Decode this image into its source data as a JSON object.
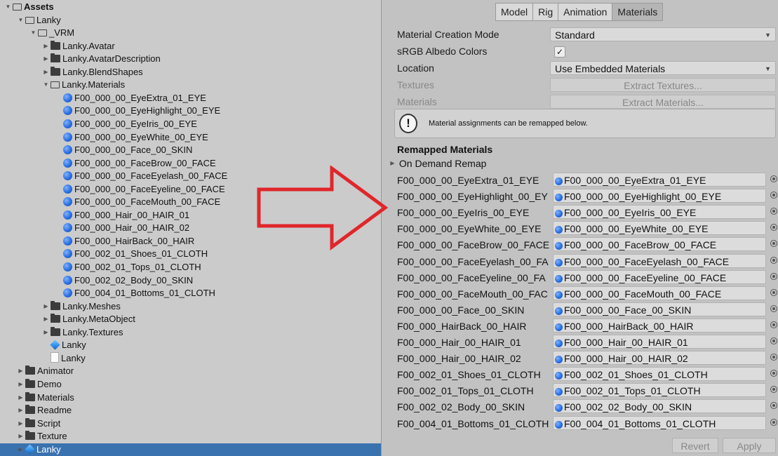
{
  "project_tree": [
    {
      "label": "Assets",
      "depth": 0,
      "expand": "open",
      "icon": "folder-open",
      "bold": true
    },
    {
      "label": "Lanky",
      "depth": 1,
      "expand": "open",
      "icon": "folder-open"
    },
    {
      "label": "_VRM",
      "depth": 2,
      "expand": "open",
      "icon": "folder-open"
    },
    {
      "label": "Lanky.Avatar",
      "depth": 3,
      "expand": "closed",
      "icon": "folder"
    },
    {
      "label": "Lanky.AvatarDescription",
      "depth": 3,
      "expand": "closed",
      "icon": "folder"
    },
    {
      "label": "Lanky.BlendShapes",
      "depth": 3,
      "expand": "closed",
      "icon": "folder"
    },
    {
      "label": "Lanky.Materials",
      "depth": 3,
      "expand": "open",
      "icon": "folder-open"
    },
    {
      "label": "F00_000_00_EyeExtra_01_EYE",
      "depth": 4,
      "expand": "none",
      "icon": "material"
    },
    {
      "label": "F00_000_00_EyeHighlight_00_EYE",
      "depth": 4,
      "expand": "none",
      "icon": "material"
    },
    {
      "label": "F00_000_00_EyeIris_00_EYE",
      "depth": 4,
      "expand": "none",
      "icon": "material"
    },
    {
      "label": "F00_000_00_EyeWhite_00_EYE",
      "depth": 4,
      "expand": "none",
      "icon": "material"
    },
    {
      "label": "F00_000_00_Face_00_SKIN",
      "depth": 4,
      "expand": "none",
      "icon": "material"
    },
    {
      "label": "F00_000_00_FaceBrow_00_FACE",
      "depth": 4,
      "expand": "none",
      "icon": "material"
    },
    {
      "label": "F00_000_00_FaceEyelash_00_FACE",
      "depth": 4,
      "expand": "none",
      "icon": "material"
    },
    {
      "label": "F00_000_00_FaceEyeline_00_FACE",
      "depth": 4,
      "expand": "none",
      "icon": "material"
    },
    {
      "label": "F00_000_00_FaceMouth_00_FACE",
      "depth": 4,
      "expand": "none",
      "icon": "material"
    },
    {
      "label": "F00_000_Hair_00_HAIR_01",
      "depth": 4,
      "expand": "none",
      "icon": "material"
    },
    {
      "label": "F00_000_Hair_00_HAIR_02",
      "depth": 4,
      "expand": "none",
      "icon": "material"
    },
    {
      "label": "F00_000_HairBack_00_HAIR",
      "depth": 4,
      "expand": "none",
      "icon": "material"
    },
    {
      "label": "F00_002_01_Shoes_01_CLOTH",
      "depth": 4,
      "expand": "none",
      "icon": "material"
    },
    {
      "label": "F00_002_01_Tops_01_CLOTH",
      "depth": 4,
      "expand": "none",
      "icon": "material"
    },
    {
      "label": "F00_002_02_Body_00_SKIN",
      "depth": 4,
      "expand": "none",
      "icon": "material"
    },
    {
      "label": "F00_004_01_Bottoms_01_CLOTH",
      "depth": 4,
      "expand": "none",
      "icon": "material"
    },
    {
      "label": "Lanky.Meshes",
      "depth": 3,
      "expand": "closed",
      "icon": "folder"
    },
    {
      "label": "Lanky.MetaObject",
      "depth": 3,
      "expand": "closed",
      "icon": "folder"
    },
    {
      "label": "Lanky.Textures",
      "depth": 3,
      "expand": "closed",
      "icon": "folder"
    },
    {
      "label": "Lanky",
      "depth": 3,
      "expand": "none",
      "icon": "prefab"
    },
    {
      "label": "Lanky",
      "depth": 3,
      "expand": "none",
      "icon": "file"
    },
    {
      "label": "Animator",
      "depth": 1,
      "expand": "closed",
      "icon": "folder"
    },
    {
      "label": "Demo",
      "depth": 1,
      "expand": "closed",
      "icon": "folder"
    },
    {
      "label": "Materials",
      "depth": 1,
      "expand": "closed",
      "icon": "folder"
    },
    {
      "label": "Readme",
      "depth": 1,
      "expand": "closed",
      "icon": "folder"
    },
    {
      "label": "Script",
      "depth": 1,
      "expand": "closed",
      "icon": "folder"
    },
    {
      "label": "Texture",
      "depth": 1,
      "expand": "closed",
      "icon": "folder"
    },
    {
      "label": "Lanky",
      "depth": 1,
      "expand": "closed",
      "icon": "prefab",
      "selected": true
    }
  ],
  "inspector": {
    "tabs": [
      "Model",
      "Rig",
      "Animation",
      "Materials"
    ],
    "active_tab": "Materials",
    "material_creation_mode": {
      "label": "Material Creation Mode",
      "value": "Standard"
    },
    "srgb": {
      "label": "sRGB Albedo Colors",
      "checked": true,
      "mark": "✓"
    },
    "location": {
      "label": "Location",
      "value": "Use Embedded Materials"
    },
    "textures": {
      "label": "Textures",
      "button": "Extract Textures..."
    },
    "materials": {
      "label": "Materials",
      "button": "Extract Materials..."
    },
    "help": {
      "icon": "!",
      "text": "Material assignments can be remapped below."
    },
    "remapped_title": "Remapped Materials",
    "on_demand": "On Demand Remap",
    "remaps": [
      {
        "name": "F00_000_00_EyeExtra_01_EYE",
        "value": "F00_000_00_EyeExtra_01_EYE"
      },
      {
        "name": "F00_000_00_EyeHighlight_00_EY",
        "value": "F00_000_00_EyeHighlight_00_EYE"
      },
      {
        "name": "F00_000_00_EyeIris_00_EYE",
        "value": "F00_000_00_EyeIris_00_EYE"
      },
      {
        "name": "F00_000_00_EyeWhite_00_EYE",
        "value": "F00_000_00_EyeWhite_00_EYE"
      },
      {
        "name": "F00_000_00_FaceBrow_00_FACE",
        "value": "F00_000_00_FaceBrow_00_FACE"
      },
      {
        "name": "F00_000_00_FaceEyelash_00_FA",
        "value": "F00_000_00_FaceEyelash_00_FACE"
      },
      {
        "name": "F00_000_00_FaceEyeline_00_FA",
        "value": "F00_000_00_FaceEyeline_00_FACE"
      },
      {
        "name": "F00_000_00_FaceMouth_00_FAC",
        "value": "F00_000_00_FaceMouth_00_FACE"
      },
      {
        "name": "F00_000_00_Face_00_SKIN",
        "value": "F00_000_00_Face_00_SKIN"
      },
      {
        "name": "F00_000_HairBack_00_HAIR",
        "value": "F00_000_HairBack_00_HAIR"
      },
      {
        "name": "F00_000_Hair_00_HAIR_01",
        "value": "F00_000_Hair_00_HAIR_01"
      },
      {
        "name": "F00_000_Hair_00_HAIR_02",
        "value": "F00_000_Hair_00_HAIR_02"
      },
      {
        "name": "F00_002_01_Shoes_01_CLOTH",
        "value": "F00_002_01_Shoes_01_CLOTH"
      },
      {
        "name": "F00_002_01_Tops_01_CLOTH",
        "value": "F00_002_01_Tops_01_CLOTH"
      },
      {
        "name": "F00_002_02_Body_00_SKIN",
        "value": "F00_002_02_Body_00_SKIN"
      },
      {
        "name": "F00_004_01_Bottoms_01_CLOTH",
        "value": "F00_004_01_Bottoms_01_CLOTH"
      }
    ],
    "revert": "Revert",
    "apply": "Apply"
  },
  "colors": {
    "arrow": "#e0262b",
    "selection": "#3a72b0",
    "material_icon": "#2a6fe0"
  }
}
